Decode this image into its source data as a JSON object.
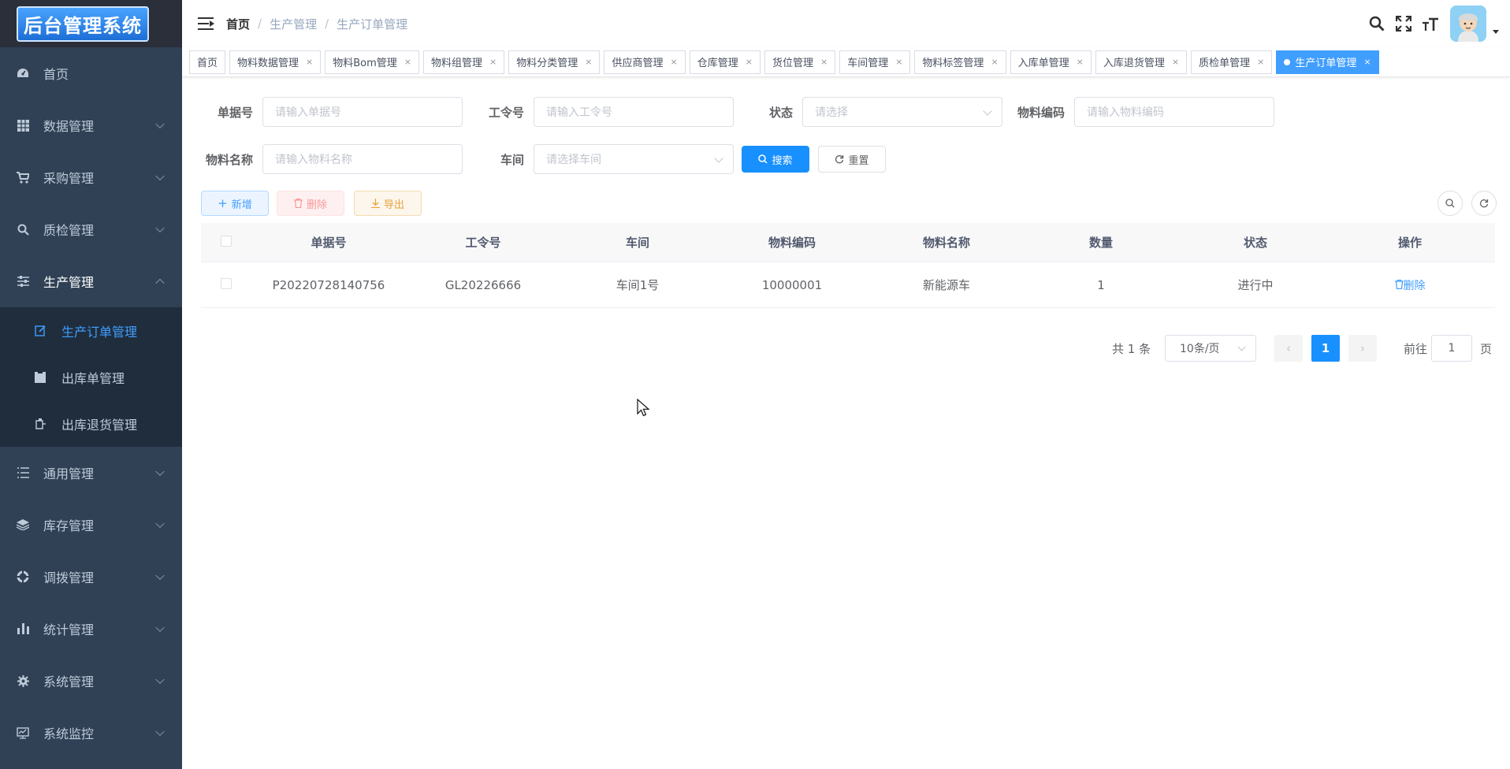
{
  "app": {
    "logo_text": "后台管理系统"
  },
  "sidebar": {
    "items": [
      {
        "label": "首页",
        "icon": "dashboard-icon"
      },
      {
        "label": "数据管理",
        "icon": "table-icon"
      },
      {
        "label": "采购管理",
        "icon": "cart-icon"
      },
      {
        "label": "质检管理",
        "icon": "search-icon"
      },
      {
        "label": "生产管理",
        "icon": "sliders-icon"
      },
      {
        "label": "通用管理",
        "icon": "list-icon"
      },
      {
        "label": "库存管理",
        "icon": "layers-icon"
      },
      {
        "label": "调拨管理",
        "icon": "transfer-icon"
      },
      {
        "label": "统计管理",
        "icon": "bar-chart-icon"
      },
      {
        "label": "系统管理",
        "icon": "gear-icon"
      },
      {
        "label": "系统监控",
        "icon": "monitor-icon"
      }
    ],
    "sub_items": [
      {
        "label": "生产订单管理",
        "icon": "edit-icon",
        "active": true
      },
      {
        "label": "出库单管理",
        "icon": "clipboard-icon"
      },
      {
        "label": "出库退货管理",
        "icon": "return-icon"
      }
    ]
  },
  "breadcrumb": {
    "home": "首页",
    "level1": "生产管理",
    "level2": "生产订单管理"
  },
  "tags": [
    {
      "label": "首页",
      "closable": false
    },
    {
      "label": "物料数据管理",
      "closable": true
    },
    {
      "label": "物料Bom管理",
      "closable": true
    },
    {
      "label": "物料组管理",
      "closable": true
    },
    {
      "label": "物料分类管理",
      "closable": true
    },
    {
      "label": "供应商管理",
      "closable": true
    },
    {
      "label": "仓库管理",
      "closable": true
    },
    {
      "label": "货位管理",
      "closable": true
    },
    {
      "label": "车间管理",
      "closable": true
    },
    {
      "label": "物料标签管理",
      "closable": true
    },
    {
      "label": "入库单管理",
      "closable": true
    },
    {
      "label": "入库退货管理",
      "closable": true
    },
    {
      "label": "质检单管理",
      "closable": true
    },
    {
      "label": "生产订单管理",
      "closable": true,
      "active": true
    }
  ],
  "tag_close": "×",
  "search": {
    "order_no_label": "单据号",
    "order_no_placeholder": "请输入单据号",
    "work_no_label": "工令号",
    "work_no_placeholder": "请输入工令号",
    "status_label": "状态",
    "status_placeholder": "请选择",
    "material_code_label": "物料编码",
    "material_code_placeholder": "请输入物料编码",
    "material_name_label": "物料名称",
    "material_name_placeholder": "请输入物料名称",
    "workshop_label": "车间",
    "workshop_placeholder": "请选择车间",
    "search_button": "搜索",
    "reset_button": "重置"
  },
  "toolbar": {
    "add": "新增",
    "delete": "删除",
    "export": "导出"
  },
  "table": {
    "headers": [
      "单据号",
      "工令号",
      "车间",
      "物料编码",
      "物料名称",
      "数量",
      "状态",
      "操作"
    ],
    "rows": [
      {
        "order_no": "P20220728140756",
        "work_no": "GL20226666",
        "workshop": "车间1号",
        "material_code": "10000001",
        "material_name": "新能源车",
        "qty": "1",
        "status": "进行中",
        "action": "删除"
      }
    ]
  },
  "pagination": {
    "total": "共 1 条",
    "page_size": "10条/页",
    "current": "1",
    "goto_prefix": "前往",
    "goto_value": "1",
    "goto_suffix": "页"
  },
  "colors": {
    "sidebar_bg": "#304156",
    "submenu_bg": "#1f2d3d",
    "accent": "#1890ff",
    "active_text": "#409eff"
  }
}
